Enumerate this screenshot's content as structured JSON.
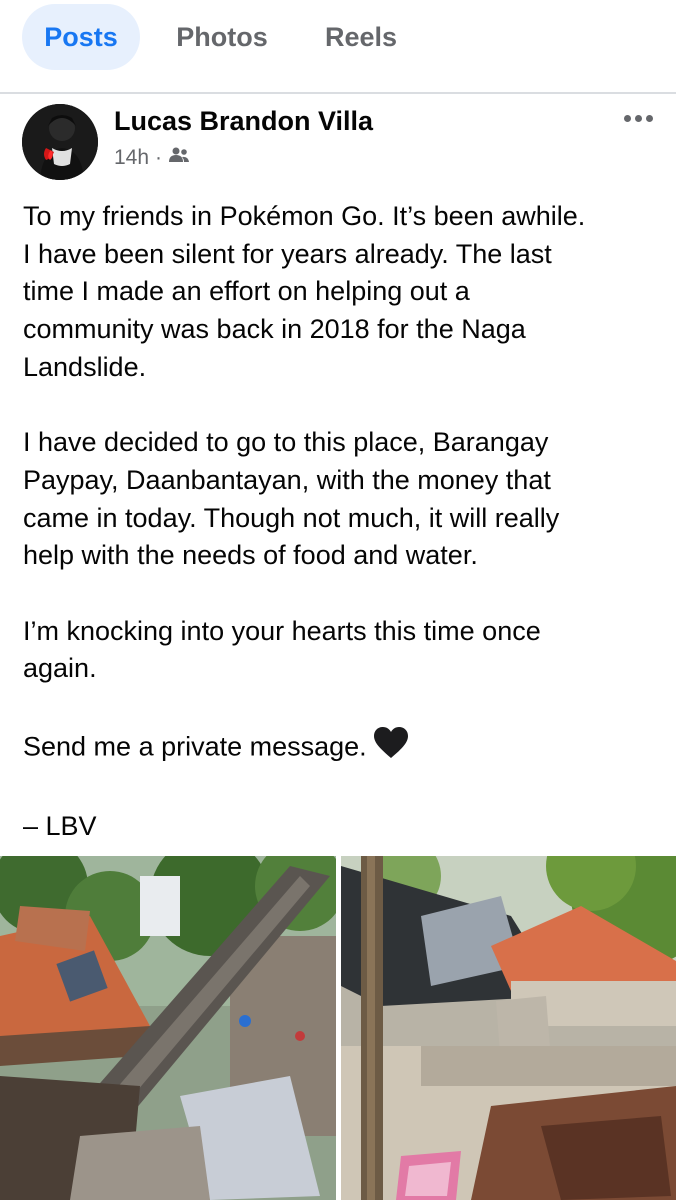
{
  "tabs": [
    {
      "label": "Posts",
      "active": true
    },
    {
      "label": "Photos",
      "active": false
    },
    {
      "label": "Reels",
      "active": false
    }
  ],
  "post": {
    "author": "Lucas Brandon Villa",
    "time": "14h",
    "separator": "·",
    "audience_icon": "friends-icon",
    "paragraphs": {
      "p1": {
        "l1": "To my friends in Pokémon Go. It’s been awhile.",
        "l2": "I have been silent for years already. The last",
        "l3": "time I made an effort on helping out a",
        "l4": "community was back in 2018 for the Naga",
        "l5": "Landslide."
      },
      "p2": {
        "l1": "I have decided to go to this place, Barangay",
        "l2": "Paypay, Daanbantayan, with the money that",
        "l3": "came in today. Though not much, it will really",
        "l4": "help with the needs of food and water."
      },
      "p3": {
        "l1": "I’m knocking into your hearts this time once",
        "l2": "again."
      },
      "p4": "Send me a private message.",
      "p5": "– LBV"
    },
    "heart_color": "#1c1c1e",
    "accent": "#1877f2"
  }
}
